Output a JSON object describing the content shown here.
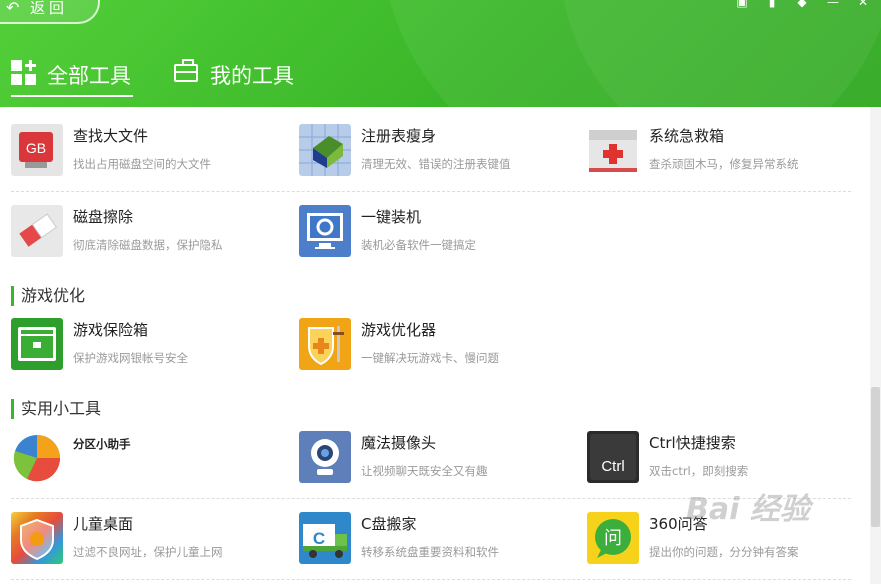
{
  "header": {
    "back_label": "返回",
    "back_arrow": "↶",
    "window_controls": [
      "▣",
      "▮",
      "◆",
      "—",
      "✕"
    ]
  },
  "tabs": [
    {
      "label": "全部工具",
      "active": true,
      "icon": "grid-icon"
    },
    {
      "label": "我的工具",
      "active": false,
      "icon": "toolbox-icon"
    }
  ],
  "sections": {
    "game": "游戏优化",
    "utility": "实用小工具"
  },
  "tools": {
    "find_big_file": {
      "name": "查找大文件",
      "desc": "找出占用磁盘空间的大文件",
      "icon": "gb-file-icon",
      "glyph": "GB"
    },
    "registry_slim": {
      "name": "注册表瘦身",
      "desc": "清理无效、错误的注册表键值",
      "icon": "registry-cube-icon"
    },
    "system_rescue": {
      "name": "系统急救箱",
      "desc": "查杀顽固木马，修复异常系统",
      "icon": "first-aid-kit-icon"
    },
    "disk_wipe": {
      "name": "磁盘擦除",
      "desc": "彻底清除磁盘数据，保护隐私",
      "icon": "eraser-icon"
    },
    "one_click_install": {
      "name": "一键装机",
      "desc": "装机必备软件一键搞定",
      "icon": "monitor-install-icon"
    },
    "game_vault": {
      "name": "游戏保险箱",
      "desc": "保护游戏网银帐号安全",
      "icon": "safe-box-icon"
    },
    "game_optimizer": {
      "name": "游戏优化器",
      "desc": "一键解决玩游戏卡、慢问题",
      "icon": "game-shield-icon"
    },
    "partition_helper": {
      "name": "分区小助手",
      "desc": "",
      "icon": "pie-chart-icon"
    },
    "magic_camera": {
      "name": "魔法摄像头",
      "desc": "让视频聊天既安全又有趣",
      "icon": "webcam-icon"
    },
    "ctrl_search": {
      "name": "Ctrl快捷搜索",
      "desc": "双击ctrl，即刻搜索",
      "icon": "ctrl-key-icon",
      "glyph": "Ctrl"
    },
    "kids_desktop": {
      "name": "儿童桌面",
      "desc": "过滤不良网址，保护儿童上网",
      "icon": "rainbow-shield-icon"
    },
    "c_mover": {
      "name": "C盘搬家",
      "desc": "转移系统盘重要资料和软件",
      "icon": "truck-c-icon",
      "glyph": "C"
    },
    "qa_360": {
      "name": "360问答",
      "desc": "提出你的问题，分分钟有答案",
      "icon": "question-bubble-icon",
      "glyph": "问"
    }
  },
  "watermark": "Bai 经验",
  "colors": {
    "header_green": "#3ab629",
    "accent_green": "#3ab629",
    "text_dark": "#222222",
    "text_gray": "#9a9a9a"
  }
}
